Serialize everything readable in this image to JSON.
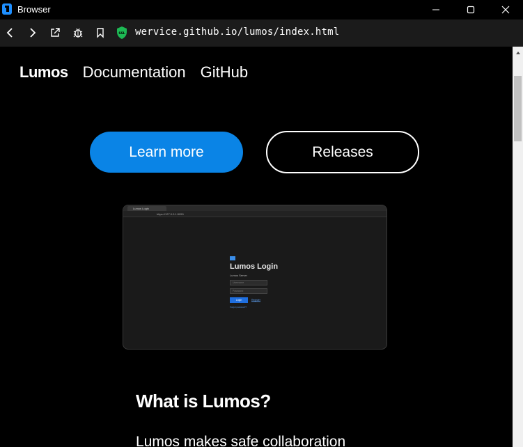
{
  "window": {
    "title": "Browser"
  },
  "browser": {
    "url": "wervice.github.io/lumos/index.html",
    "ssl_badge": "SSL"
  },
  "site_nav": {
    "brand": "Lumos",
    "links": [
      "Documentation",
      "GitHub"
    ]
  },
  "hero": {
    "learn_more": "Learn more",
    "releases": "Releases"
  },
  "screenshot": {
    "tab_title": "Lumos Login",
    "url": "https://127.0.0.1:5050",
    "login_title": "Lumos Login",
    "login_sub": "Lumos Server",
    "username_placeholder": "Username",
    "password_placeholder": "Password",
    "login_button": "Login",
    "register_link": "Register",
    "forgot_link": "Forgot password?"
  },
  "section": {
    "title": "What is Lumos?",
    "text": "Lumos makes safe collaboration"
  },
  "colors": {
    "accent": "#0a84e6",
    "ssl_green": "#1db954"
  }
}
